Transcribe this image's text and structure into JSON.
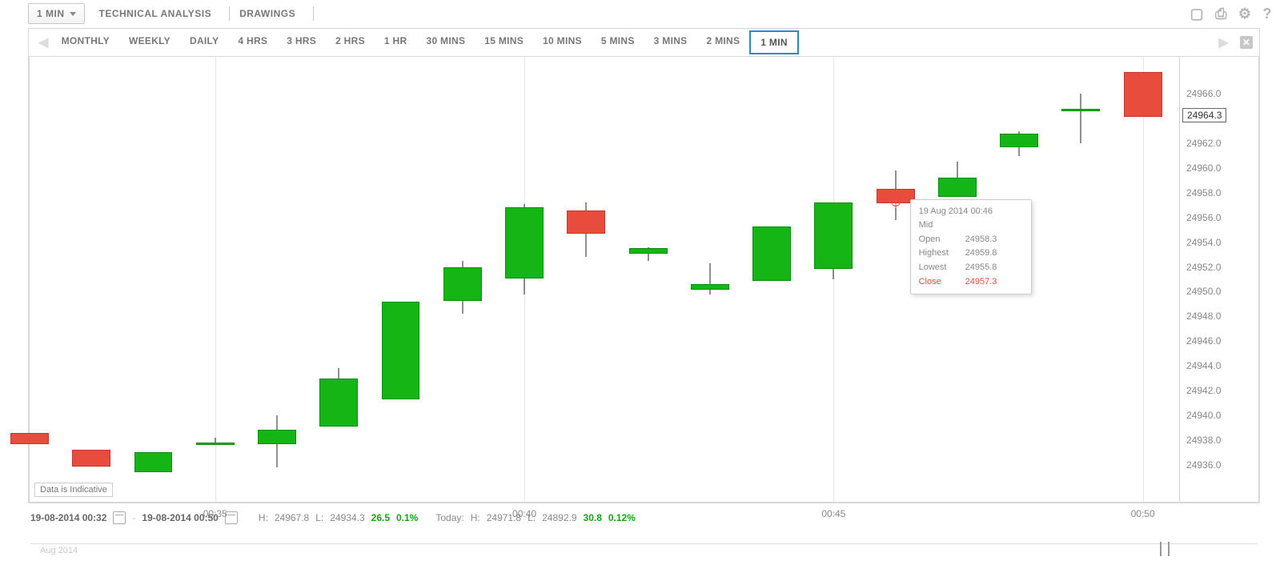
{
  "toolbar": {
    "interval_label": "1 MIN",
    "technical_label": "TECHNICAL ANALYSIS",
    "drawings_label": "DRAWINGS"
  },
  "timeframes": [
    {
      "label": "MONTHLY"
    },
    {
      "label": "WEEKLY"
    },
    {
      "label": "DAILY"
    },
    {
      "label": "4 HRS"
    },
    {
      "label": "3 HRS"
    },
    {
      "label": "2 HRS"
    },
    {
      "label": "1 HR"
    },
    {
      "label": "30 MINS"
    },
    {
      "label": "15 MINS"
    },
    {
      "label": "10 MINS"
    },
    {
      "label": "5 MINS"
    },
    {
      "label": "3 MINS"
    },
    {
      "label": "2 MINS"
    },
    {
      "label": "1 MIN",
      "active": true
    }
  ],
  "yaxis": {
    "ticks": [
      24936.0,
      24938.0,
      24940.0,
      24942.0,
      24944.0,
      24946.0,
      24948.0,
      24950.0,
      24952.0,
      24954.0,
      24956.0,
      24958.0,
      24960.0,
      24962.0,
      24966.0
    ],
    "current_price": 24964.3,
    "min": 24933.0,
    "max": 24969.0
  },
  "xaxis": {
    "labels": [
      "00:35",
      "00:40",
      "00:45",
      "00:50"
    ],
    "positions": [
      0.145,
      0.415,
      0.683,
      0.952
    ]
  },
  "note": "Data is Indicative",
  "tooltip": {
    "datetime": "19 Aug 2014 00:46",
    "type": "Mid",
    "open_label": "Open",
    "open": "24958.3",
    "high_label": "Highest",
    "high": "24959.8",
    "low_label": "Lowest",
    "low": "24955.8",
    "close_label": "Close",
    "close": "24957.3"
  },
  "footer": {
    "from": "19-08-2014 00:32",
    "dash": "-",
    "to": "19-08-2014 00:50",
    "h_label": "H:",
    "h": "24967.8",
    "l_label": "L:",
    "l": "24934.3",
    "change": "26.5",
    "change_pct": "0.1%",
    "today_label": "Today:",
    "today_h_label": "H:",
    "today_h": "24971.8",
    "today_l_label": "L:",
    "today_l": "24892.9",
    "today_change": "30.8",
    "today_change_pct": "0.12%",
    "nav_month": "Aug 2014"
  },
  "chart_data": {
    "type": "candlestick",
    "title": "",
    "xlabel": "",
    "ylabel": "",
    "ylim": [
      24933.0,
      24969.0
    ],
    "x_times": [
      "00:32",
      "00:33",
      "00:34",
      "00:35",
      "00:36",
      "00:37",
      "00:38",
      "00:39",
      "00:40",
      "00:41",
      "00:42",
      "00:43",
      "00:44",
      "00:45",
      "00:46",
      "00:47",
      "00:48",
      "00:49",
      "00:50"
    ],
    "candles": [
      {
        "t": "00:32",
        "o": 24938.6,
        "h": 24938.6,
        "l": 24937.8,
        "c": 24937.8,
        "dir": "dn"
      },
      {
        "t": "00:33",
        "o": 24937.2,
        "h": 24937.2,
        "l": 24936.0,
        "c": 24936.0,
        "dir": "dn"
      },
      {
        "t": "00:34",
        "o": 24935.5,
        "h": 24937.0,
        "l": 24935.5,
        "c": 24937.0,
        "dir": "up"
      },
      {
        "t": "00:35",
        "o": 24937.8,
        "h": 24938.2,
        "l": 24937.6,
        "c": 24937.8,
        "dir": "up"
      },
      {
        "t": "00:36",
        "o": 24937.8,
        "h": 24940.0,
        "l": 24935.8,
        "c": 24938.8,
        "dir": "up"
      },
      {
        "t": "00:37",
        "o": 24939.2,
        "h": 24943.8,
        "l": 24939.2,
        "c": 24943.0,
        "dir": "up"
      },
      {
        "t": "00:38",
        "o": 24941.4,
        "h": 24949.2,
        "l": 24941.4,
        "c": 24949.2,
        "dir": "up"
      },
      {
        "t": "00:39",
        "o": 24949.4,
        "h": 24952.5,
        "l": 24948.2,
        "c": 24952.0,
        "dir": "up"
      },
      {
        "t": "00:40",
        "o": 24951.2,
        "h": 24957.1,
        "l": 24949.8,
        "c": 24956.8,
        "dir": "up"
      },
      {
        "t": "00:41",
        "o": 24956.6,
        "h": 24957.2,
        "l": 24952.8,
        "c": 24954.8,
        "dir": "dn"
      },
      {
        "t": "00:42",
        "o": 24953.2,
        "h": 24953.6,
        "l": 24952.5,
        "c": 24953.5,
        "dir": "up"
      },
      {
        "t": "00:43",
        "o": 24950.3,
        "h": 24952.3,
        "l": 24949.8,
        "c": 24950.6,
        "dir": "up"
      },
      {
        "t": "00:44",
        "o": 24951.0,
        "h": 24955.3,
        "l": 24951.0,
        "c": 24955.3,
        "dir": "up"
      },
      {
        "t": "00:45",
        "o": 24952.0,
        "h": 24957.2,
        "l": 24951.0,
        "c": 24957.2,
        "dir": "up"
      },
      {
        "t": "00:46",
        "o": 24958.3,
        "h": 24959.8,
        "l": 24955.8,
        "c": 24957.3,
        "dir": "dn"
      },
      {
        "t": "00:47",
        "o": 24957.8,
        "h": 24960.5,
        "l": 24957.8,
        "c": 24959.2,
        "dir": "up"
      },
      {
        "t": "00:48",
        "o": 24961.8,
        "h": 24963.0,
        "l": 24961.0,
        "c": 24962.8,
        "dir": "up"
      },
      {
        "t": "00:49",
        "o": 24964.8,
        "h": 24966.0,
        "l": 24962.0,
        "c": 24964.8,
        "dir": "up"
      },
      {
        "t": "00:50",
        "o": 24967.8,
        "h": 24967.8,
        "l": 24964.3,
        "c": 24964.3,
        "dir": "dn"
      }
    ]
  }
}
